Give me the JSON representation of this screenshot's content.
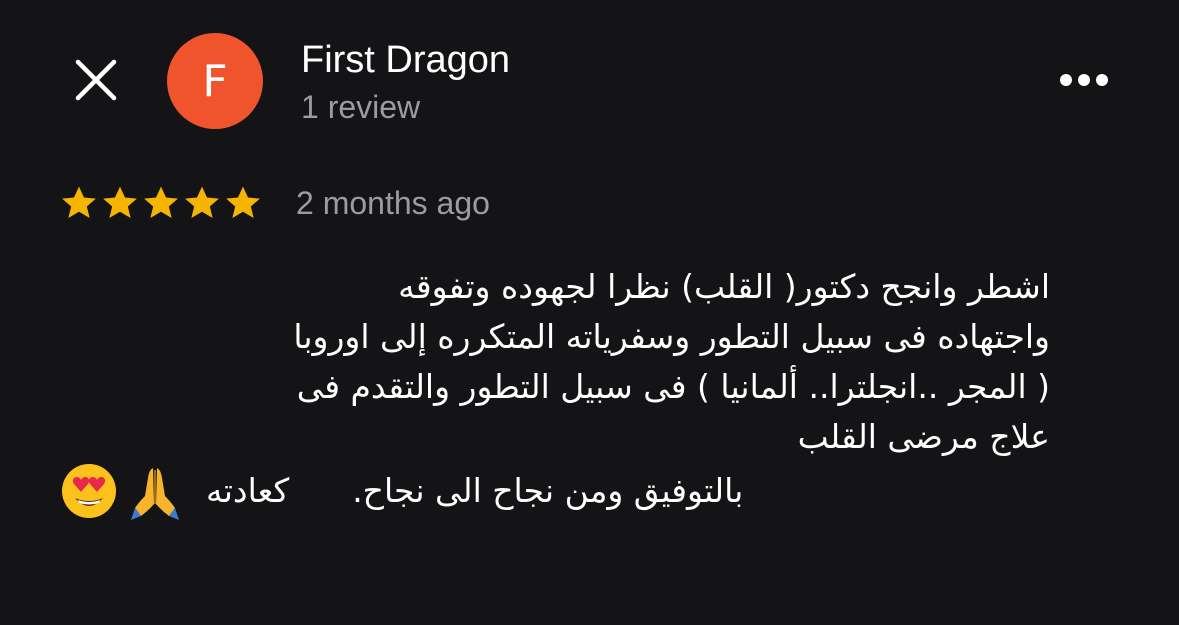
{
  "header": {
    "close_icon": "close-icon",
    "avatar_letter": "F",
    "avatar_color": "#f0542d",
    "user_name": "First Dragon",
    "review_count": "1 review",
    "more_icon": "more-options-icon"
  },
  "rating": {
    "stars": 5,
    "max_stars": 5,
    "star_color": "#f5b400",
    "time_ago": "2 months ago"
  },
  "review": {
    "lines": [
      "اشطر وانجح دكتور( القلب) نظرا لجهوده وتفوقه",
      "واجتهاده فى سبيل التطور وسفرياته المتكرره إلى اوروبا",
      "( المجر ..انجلترا.. ألمانيا ) فى سبيل التطور والتقدم فى",
      "علاج مرضى القلب"
    ],
    "last_line": "بالتوفيق ومن نجاح الى نجاح.      كعادته",
    "emojis": [
      "folded-hands-emoji",
      "heart-eyes-emoji"
    ]
  }
}
